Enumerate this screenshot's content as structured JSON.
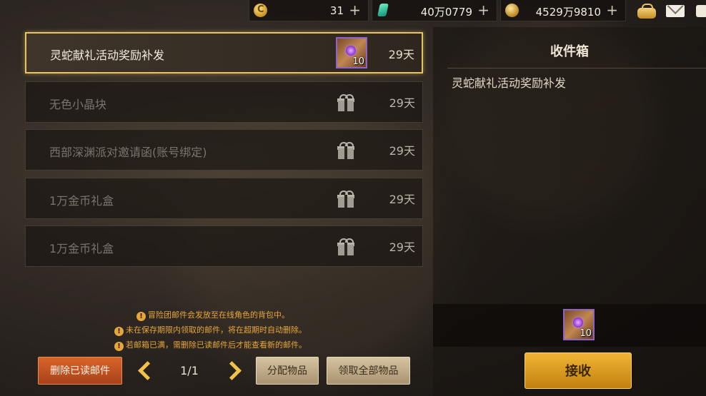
{
  "currencies": [
    {
      "icon": "c-coin-icon",
      "letter": "C",
      "value": "31"
    },
    {
      "icon": "green-gem-icon",
      "value": "40万0779"
    },
    {
      "icon": "gold-coin-icon",
      "value": "4529万9810"
    }
  ],
  "plus": "+",
  "mail_list": [
    {
      "title": "灵蛇献礼活动奖励补发",
      "days": "29天",
      "attachment_count": "10",
      "icon": "item-thumbnail"
    },
    {
      "title": "无色小晶块",
      "days": "29天",
      "icon": "gift-icon"
    },
    {
      "title": "西部深渊派对邀请函(账号绑定)",
      "days": "29天",
      "icon": "gift-icon"
    },
    {
      "title": "1万金币礼盒",
      "days": "29天",
      "icon": "gift-icon"
    },
    {
      "title": "1万金币礼盒",
      "days": "29天",
      "icon": "gift-icon"
    }
  ],
  "inbox": {
    "title": "收件箱",
    "body": "灵蛇献礼活动奖励补发",
    "attachment_count": "10",
    "receive_label": "接收"
  },
  "notices": [
    "冒险团邮件会发放至在线角色的背包中。",
    "未在保存期限内领取的邮件，将在超期时自动删除。",
    "若邮箱已满，需删除已读邮件后才能查看新的邮件。"
  ],
  "warn_glyph": "!",
  "buttons": {
    "delete_read": "删除已读邮件",
    "distribute": "分配物品",
    "claim_all": "领取全部物品"
  },
  "pagination": "1/1",
  "colors": {
    "accent_gold": "#e8c45e",
    "notice_orange": "#e6a63a",
    "delete_red": "#d8662a",
    "receive_gold": "#f0b535"
  }
}
